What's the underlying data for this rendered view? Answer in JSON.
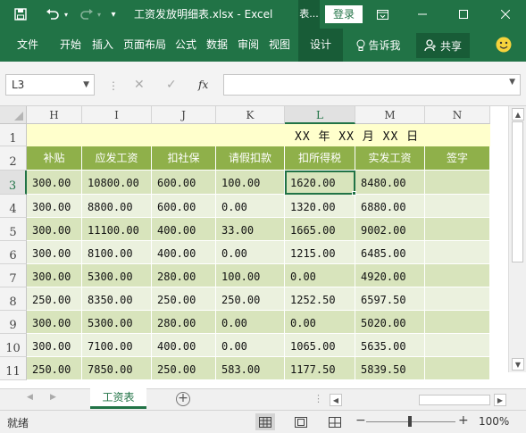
{
  "window": {
    "title": "工资发放明细表.xlsx - Excel",
    "context_tab": "表...",
    "login_label": "登录"
  },
  "ribbon": {
    "tabs": [
      "文件",
      "开始",
      "插入",
      "页面布局",
      "公式",
      "数据",
      "审阅",
      "视图",
      "设计"
    ],
    "tell_me": "告诉我",
    "share": "共享"
  },
  "formula_bar": {
    "name_box": "L3",
    "fx_label": "fx",
    "formula": ""
  },
  "grid": {
    "columns": [
      "H",
      "I",
      "J",
      "K",
      "L",
      "M",
      "N"
    ],
    "active_column": "L",
    "rows": [
      "1",
      "2",
      "3",
      "4",
      "5",
      "6",
      "7",
      "8",
      "9",
      "10",
      "11"
    ],
    "active_row": "3",
    "title_row_text": "XX 年 XX 月 XX 日",
    "headers": [
      "补贴",
      "应发工资",
      "扣社保",
      "请假扣款",
      "扣所得税",
      "实发工资",
      "签字"
    ],
    "data": [
      [
        "300.00",
        "10800.00",
        "600.00",
        "100.00",
        "1620.00",
        "8480.00",
        ""
      ],
      [
        "300.00",
        "8800.00",
        "600.00",
        "0.00",
        "1320.00",
        "6880.00",
        ""
      ],
      [
        "300.00",
        "11100.00",
        "400.00",
        "33.00",
        "1665.00",
        "9002.00",
        ""
      ],
      [
        "300.00",
        "8100.00",
        "400.00",
        "0.00",
        "1215.00",
        "6485.00",
        ""
      ],
      [
        "300.00",
        "5300.00",
        "280.00",
        "100.00",
        "0.00",
        "4920.00",
        ""
      ],
      [
        "250.00",
        "8350.00",
        "250.00",
        "250.00",
        "1252.50",
        "6597.50",
        ""
      ],
      [
        "300.00",
        "5300.00",
        "280.00",
        "0.00",
        "0.00",
        "5020.00",
        ""
      ],
      [
        "300.00",
        "7100.00",
        "400.00",
        "0.00",
        "1065.00",
        "5635.00",
        ""
      ],
      [
        "250.00",
        "7850.00",
        "250.00",
        "583.00",
        "1177.50",
        "5839.50",
        ""
      ]
    ]
  },
  "sheets": {
    "tabs": [
      "工资表"
    ],
    "active": "工资表"
  },
  "status": {
    "ready": "就绪",
    "zoom": "100%"
  },
  "colors": {
    "excel_green": "#217346",
    "header_row_fill": "#8fb04a",
    "band_dark": "#d8e4bc",
    "band_light": "#ebf1de",
    "title_fill": "#ffffcc"
  }
}
